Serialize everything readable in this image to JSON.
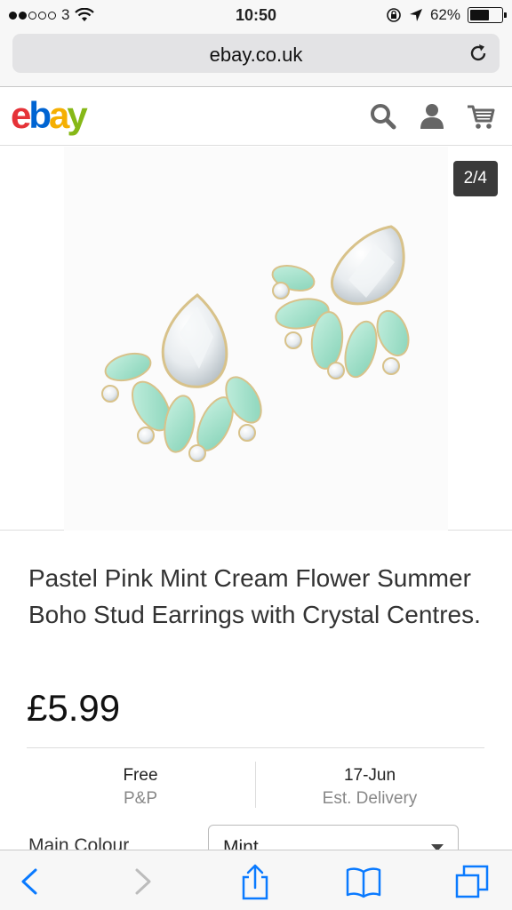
{
  "status_bar": {
    "carrier": "3",
    "time": "10:50",
    "battery_percent_label": "62%",
    "battery_level": 0.62
  },
  "browser": {
    "url": "ebay.co.uk"
  },
  "header": {
    "logo_letters": [
      "e",
      "b",
      "a",
      "y"
    ],
    "logo_colors": [
      "#e53238",
      "#0064d2",
      "#f5af02",
      "#86b817"
    ]
  },
  "gallery": {
    "counter": "2/4"
  },
  "product": {
    "title": "Pastel Pink Mint Cream Flower Summer Boho Stud Earrings with Crystal Centres.",
    "price": "£5.99",
    "shipping_value": "Free",
    "shipping_label": "P&P",
    "delivery_value": "17-Jun",
    "delivery_label": "Est. Delivery",
    "colour_label": "Main Colour",
    "colour_value": "Mint"
  },
  "colors": {
    "ios_blue": "#0a7aff",
    "mint": "#9fe0c9"
  }
}
